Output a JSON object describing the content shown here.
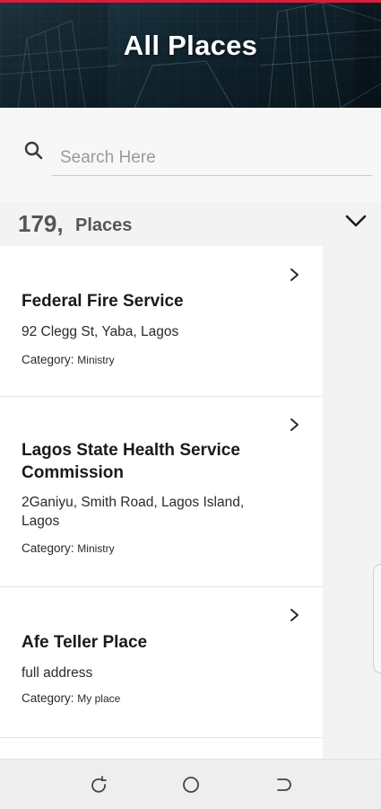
{
  "header": {
    "title": "All Places"
  },
  "search": {
    "placeholder": "Search Here",
    "value": ""
  },
  "summary": {
    "count": "179,",
    "label": "Places"
  },
  "places": [
    {
      "name": "Federal Fire Service",
      "address": "92 Clegg St, Yaba, Lagos",
      "category_label": "Category:",
      "category": "Ministry"
    },
    {
      "name": "Lagos State Health Service Commission",
      "address": "2Ganiyu, Smith Road, Lagos Island, Lagos",
      "category_label": "Category:",
      "category": "Ministry"
    },
    {
      "name": "Afe Teller Place",
      "address": "full address",
      "category_label": "Category:",
      "category": "My place"
    }
  ],
  "colors": {
    "accent_line": "#d81e3c",
    "header_bg": "#17313d",
    "page_bg": "#f3f3f3",
    "card_bg": "#ffffff"
  },
  "icons": {
    "search": "search-icon",
    "expand": "chevron-down-icon",
    "open_place": "chevron-right-icon",
    "nav_recent": "recent-apps-icon",
    "nav_home": "home-icon",
    "nav_back": "back-icon"
  }
}
